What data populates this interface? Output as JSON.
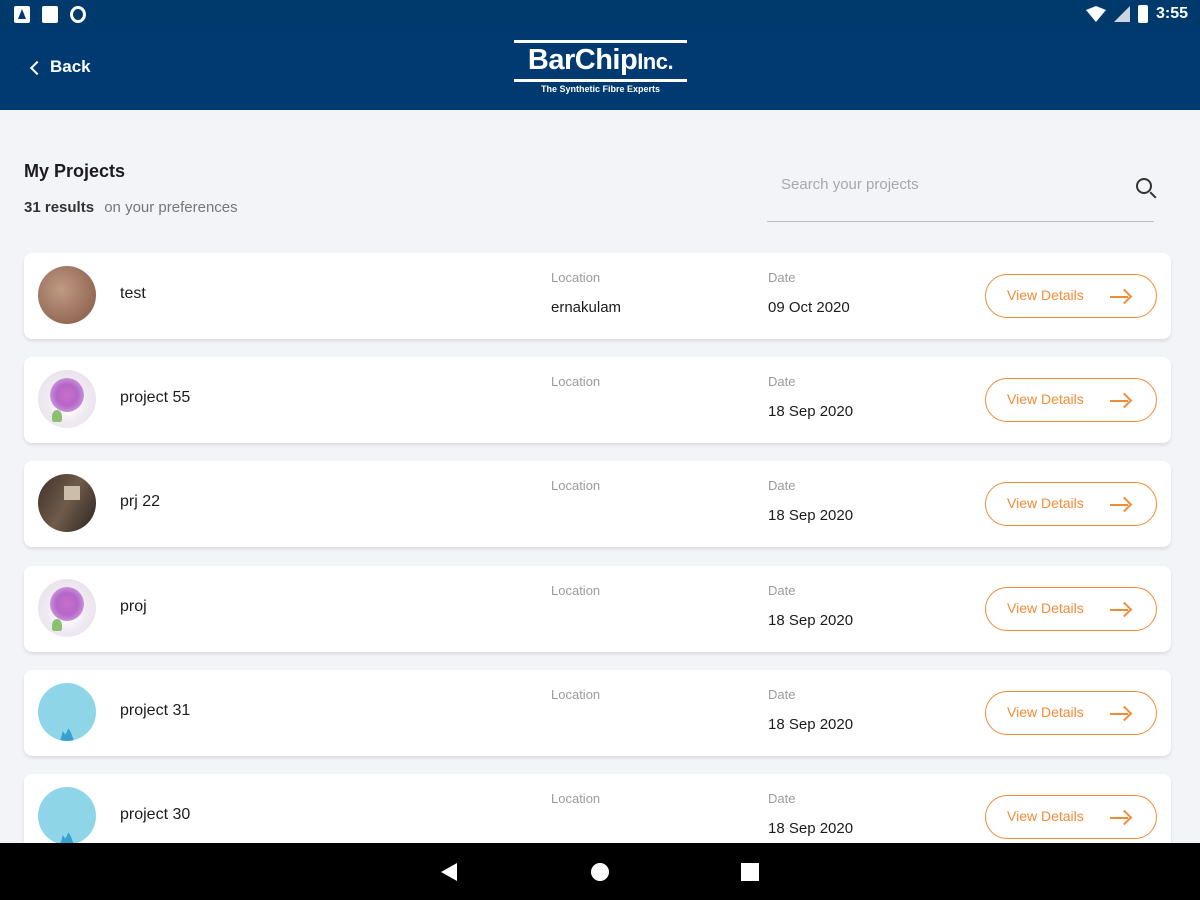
{
  "status_bar": {
    "time": "3:55"
  },
  "header": {
    "back_label": "Back",
    "logo_name": "BarChip",
    "logo_suffix": "Inc.",
    "logo_tagline": "The Synthetic Fibre Experts"
  },
  "list": {
    "title": "My Projects",
    "results_count": "31 results",
    "results_suffix": "on your preferences"
  },
  "search": {
    "placeholder": "Search your projects"
  },
  "columns": {
    "location": "Location",
    "date": "Date"
  },
  "projects": [
    {
      "name": "test",
      "location": "ernakulam",
      "date": "09 Oct 2020",
      "button": "View Details",
      "thumbnail": "brown-texture"
    },
    {
      "name": "project 55",
      "location": "",
      "date": "18 Sep 2020",
      "button": "View Details",
      "thumbnail": "lilac-flower"
    },
    {
      "name": "prj 22",
      "location": "",
      "date": "18 Sep 2020",
      "button": "View Details",
      "thumbnail": "room-photo"
    },
    {
      "name": "proj",
      "location": "",
      "date": "18 Sep 2020",
      "button": "View Details",
      "thumbnail": "lilac-flower"
    },
    {
      "name": "project 31",
      "location": "",
      "date": "18 Sep 2020",
      "button": "View Details",
      "thumbnail": "sky-city"
    },
    {
      "name": "project 30",
      "location": "",
      "date": "18 Sep 2020",
      "button": "View Details",
      "thumbnail": "sky-city"
    }
  ],
  "colors": {
    "header_bg": "#003a70",
    "accent": "#f28b37",
    "page_bg": "#f3f4f8"
  }
}
